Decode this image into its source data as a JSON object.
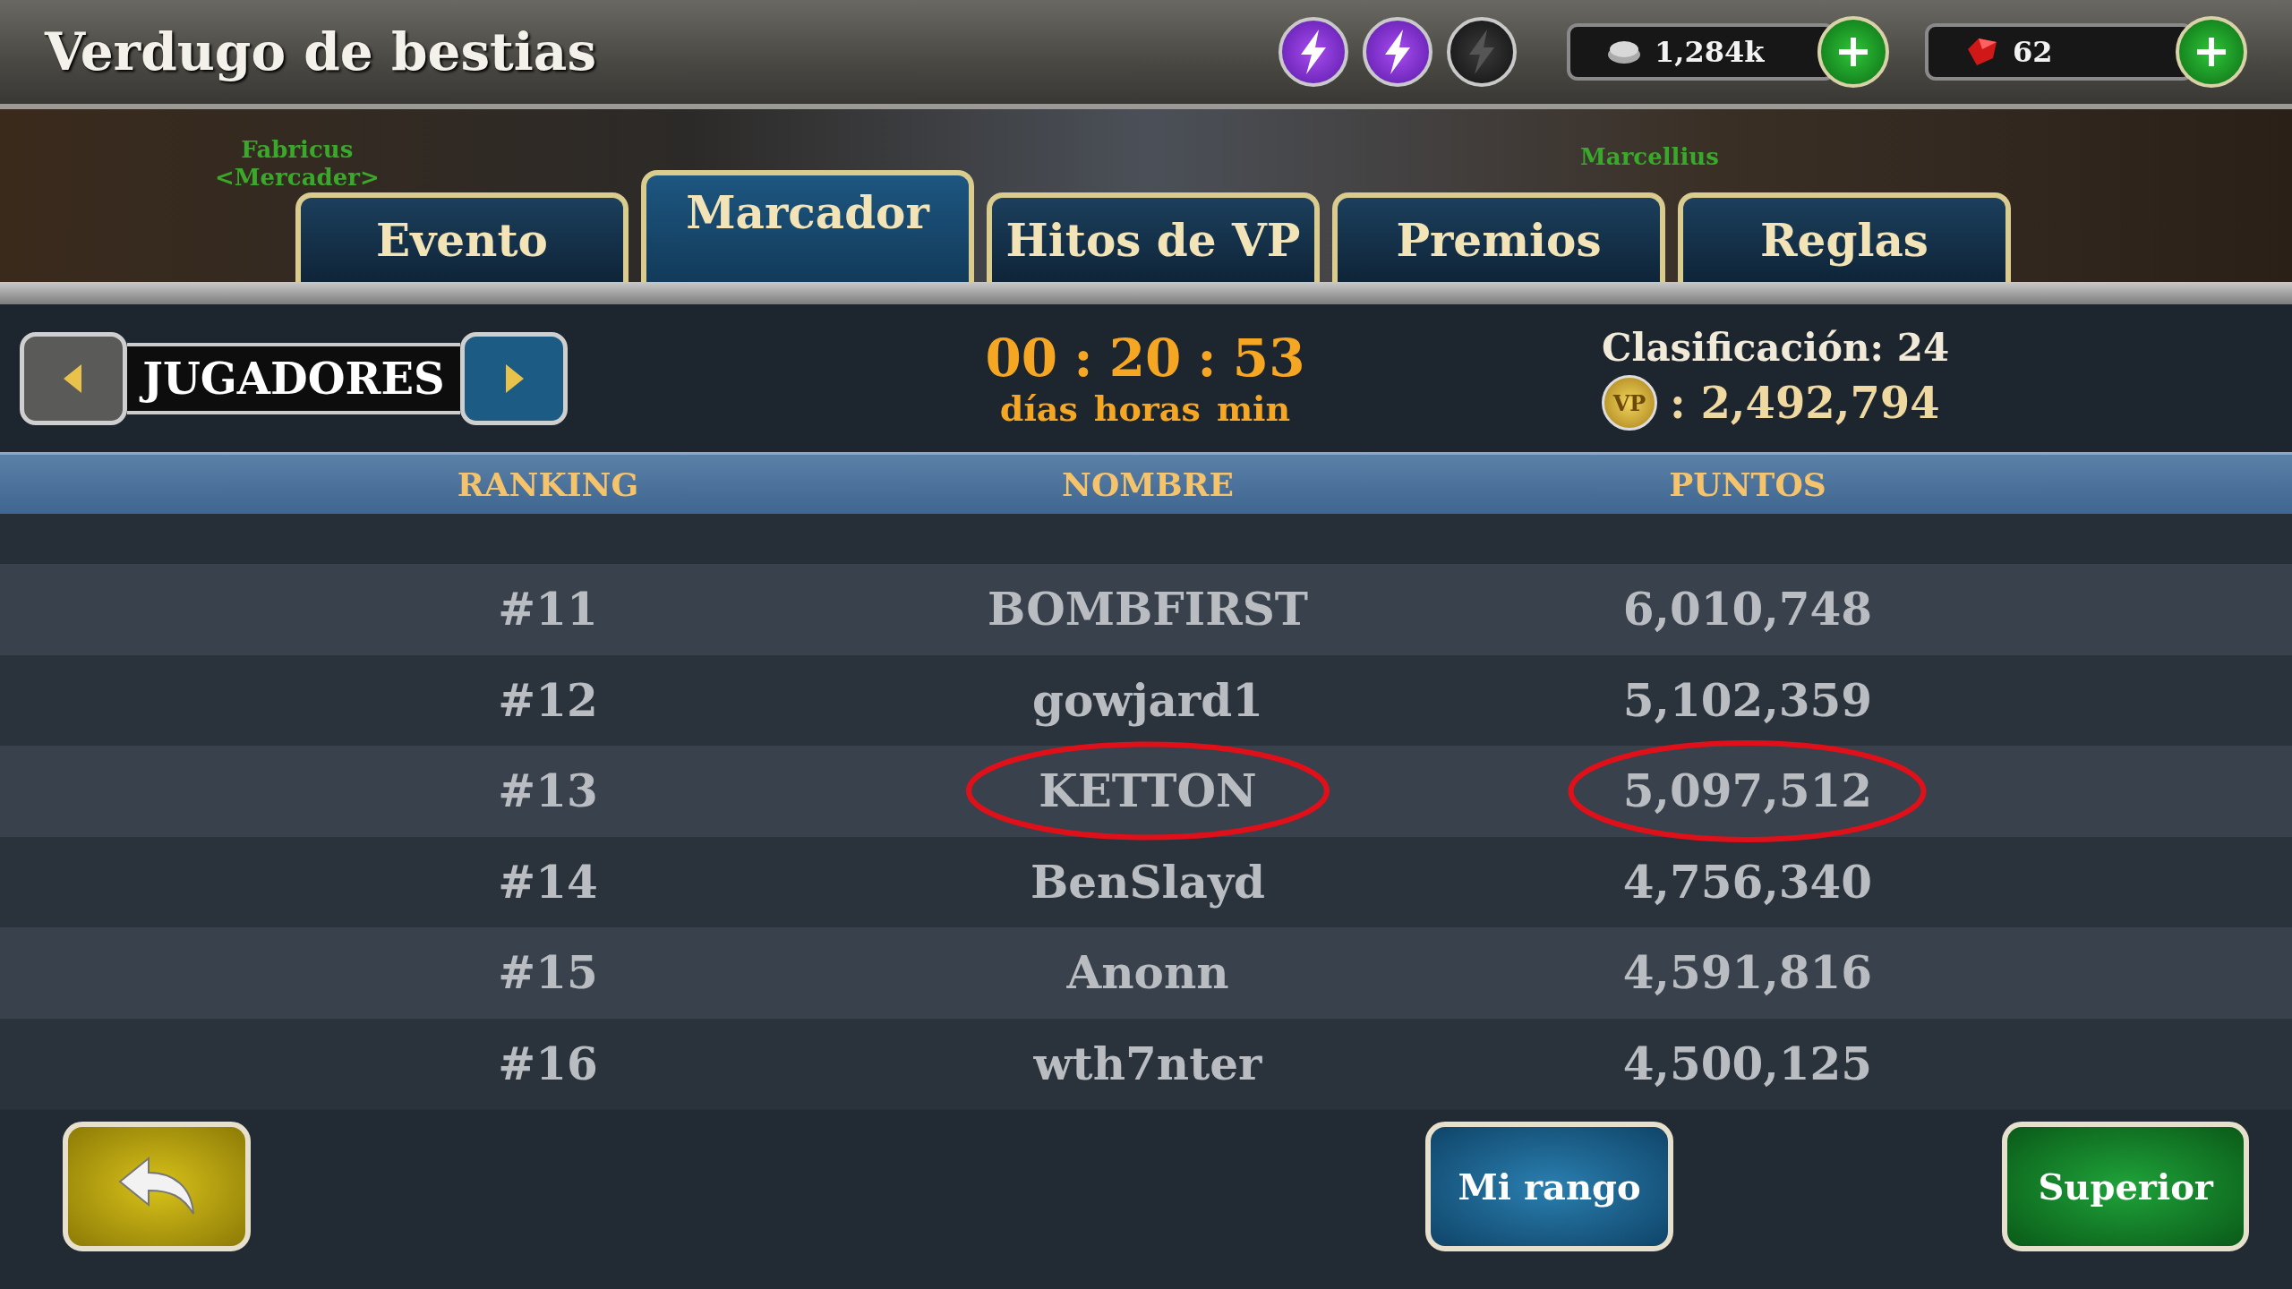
{
  "title": "Verdugo de bestias",
  "energy": [
    {
      "charged": true
    },
    {
      "charged": true
    },
    {
      "charged": false
    }
  ],
  "currencies": [
    {
      "kind": "silver",
      "amount": "1,284k"
    },
    {
      "kind": "ruby",
      "amount": "62"
    }
  ],
  "scene_labels": [
    {
      "name": "Fabricus",
      "role": "<Mercader>"
    },
    {
      "name": "Marcellius"
    }
  ],
  "tabs": [
    {
      "label": "Evento",
      "selected": false
    },
    {
      "label": "Marcador",
      "selected": true
    },
    {
      "label": "Hitos de VP",
      "selected": false
    },
    {
      "label": "Premios",
      "selected": false
    },
    {
      "label": "Reglas",
      "selected": false
    }
  ],
  "category": "JUGADORES",
  "timer": {
    "values": [
      "00",
      "20",
      "53"
    ],
    "separator": ":",
    "units": [
      "días",
      "horas",
      "min"
    ]
  },
  "standing": {
    "rank": "Clasificación: 24",
    "coin": "VP",
    "points": ": 2,492,794"
  },
  "table": {
    "columns": [
      "RANKING",
      "NOMBRE",
      "PUNTOS"
    ],
    "rows": [
      {
        "rank": "#11",
        "name": "BOMBFIRST",
        "points": "6,010,748",
        "circled": false
      },
      {
        "rank": "#12",
        "name": "gowjard1",
        "points": "5,102,359",
        "circled": false
      },
      {
        "rank": "#13",
        "name": "KETTON",
        "points": "5,097,512",
        "circled": true
      },
      {
        "rank": "#14",
        "name": "BenSlayd",
        "points": "4,756,340",
        "circled": false
      },
      {
        "rank": "#15",
        "name": "Anonn",
        "points": "4,591,816",
        "circled": false
      },
      {
        "rank": "#16",
        "name": "wth7nter",
        "points": "4,500,125",
        "circled": false
      }
    ]
  },
  "buttons": [
    {
      "kind": "back"
    },
    {
      "kind": "blue",
      "label": "Mi rango"
    },
    {
      "kind": "green",
      "label": "Superior"
    }
  ]
}
